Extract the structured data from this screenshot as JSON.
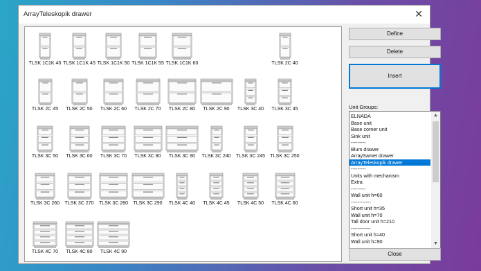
{
  "window": {
    "title": "ArrayTeleskopik drawer",
    "close_glyph": "✕"
  },
  "buttons": {
    "define": "Define",
    "delete": "Delete",
    "insert": "Insert",
    "close": "Close"
  },
  "groups": {
    "label": "Unit Groups:",
    "items": [
      "ELNADA",
      "Base unit",
      "Base corner unit",
      "Sink unit",
      "---------",
      "Blum drawer",
      "ArraySamet drawer",
      "ArrayTeleskopik drawer",
      "---------",
      "Units with mechanism",
      "Extra",
      "---------",
      "Wall unit h=60",
      "------------",
      "Short unit h=35",
      "Wall unit h=70",
      "Tall door unit h=210",
      "------------",
      "Short unit h=40",
      "Wall unit h=90"
    ],
    "selected": "ArrayTeleskopik drawer"
  },
  "units": [
    {
      "label": "TLSK 1C1K 40"
    },
    {
      "label": "TLSK 1C1K 45"
    },
    {
      "label": "TLSK 1C1K 50"
    },
    {
      "label": "TLSK 1C1K 55"
    },
    {
      "label": "TLSK 1C1K 60"
    },
    {
      "label": "TLSK 2C 40"
    },
    {
      "label": "TLSK 2C 45"
    },
    {
      "label": "TLSK 2C 50"
    },
    {
      "label": "TLSK 2C 60"
    },
    {
      "label": "TLSK 2C 70"
    },
    {
      "label": "TLSK 2C 80"
    },
    {
      "label": "TLSK 2C 90"
    },
    {
      "label": "TLSK 3C 40"
    },
    {
      "label": "TLSK 3C 45"
    },
    {
      "label": "TLSK 3C 50"
    },
    {
      "label": "TLSK 3C 60"
    },
    {
      "label": "TLSK 3C 70"
    },
    {
      "label": "TLSK 3C 80"
    },
    {
      "label": "TLSK 3C 90"
    },
    {
      "label": "TLSK 3C 240"
    },
    {
      "label": "TLSK 3C 245"
    },
    {
      "label": "TLSK 3C 250"
    },
    {
      "label": "TLSK 3C 260"
    },
    {
      "label": "TLSK 3C 270"
    },
    {
      "label": "TLSK 3C 280"
    },
    {
      "label": "TLSK 3C 290"
    },
    {
      "label": "TLSK 4C 40"
    },
    {
      "label": "TLSK 4C 45"
    },
    {
      "label": "TLSK 4C 50"
    },
    {
      "label": "TLSK 4C 60"
    },
    {
      "label": "TLSK 4C 70"
    },
    {
      "label": "TLSK 4C 80"
    },
    {
      "label": "TLSK 4C 90"
    }
  ]
}
